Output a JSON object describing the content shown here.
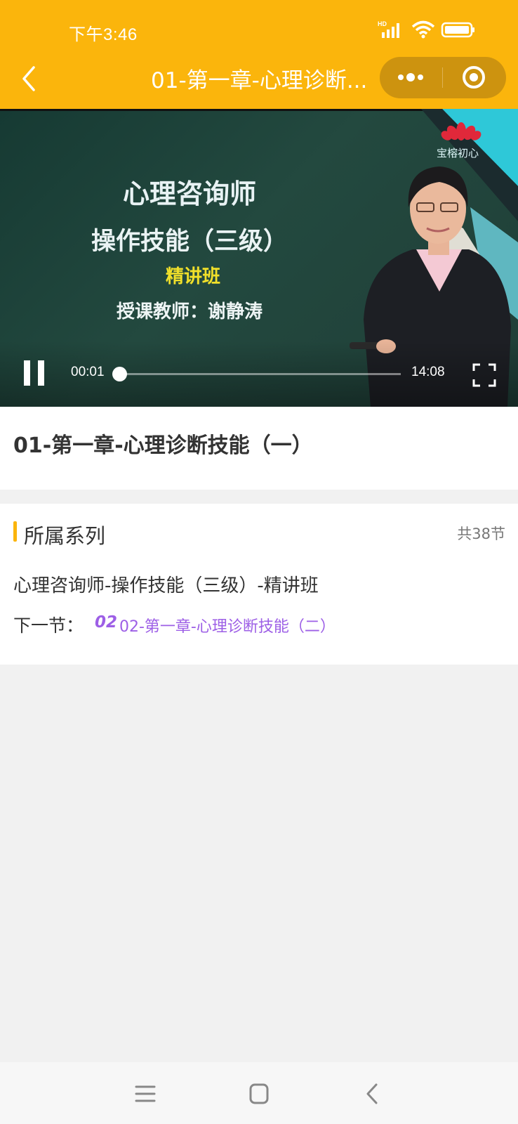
{
  "status_bar": {
    "time": "下午3:46",
    "network_label": "HD",
    "icons": [
      "signal-icon",
      "wifi-icon",
      "battery-icon"
    ]
  },
  "nav": {
    "back_icon": "chevron-left-icon",
    "title": "01-第一章-心理诊断...",
    "more_icon": "more-dots-icon",
    "close_icon": "target-close-icon",
    "bg_color": "#fbb50c"
  },
  "video": {
    "board_lines": [
      "心理咨询师",
      "操作技能（三级）",
      "精讲班",
      "授课教师：谢静涛"
    ],
    "watermark": "宝榕初心",
    "current_time": "00:01",
    "total_time": "14:08",
    "progress_fraction": 0.001,
    "pause_icon": "pause-icon",
    "fullscreen_icon": "fullscreen-icon"
  },
  "lesson": {
    "title": "01-第一章-心理诊断技能（一）"
  },
  "series": {
    "label": "所属系列",
    "count": "共38节",
    "name": "心理咨询师-操作技能（三级）-精讲班",
    "next_label": "下一节：",
    "next_number": "02",
    "next_title": "02-第一章-心理诊断技能（二）",
    "accent_color": "#9d5fe6"
  },
  "bottom_nav": {
    "icons": [
      "menu-icon",
      "home-square-icon",
      "back-chevron-icon"
    ]
  }
}
